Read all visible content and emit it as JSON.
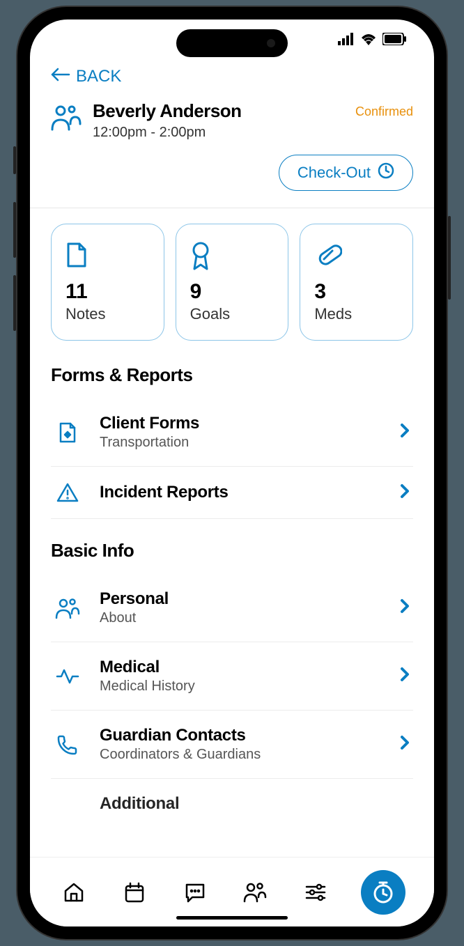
{
  "nav": {
    "back_label": "BACK"
  },
  "client": {
    "name": "Beverly Anderson",
    "time_range": "12:00pm - 2:00pm",
    "status": "Confirmed"
  },
  "checkout_label": "Check-Out",
  "cards": {
    "notes": {
      "count": "11",
      "label": "Notes"
    },
    "goals": {
      "count": "9",
      "label": "Goals"
    },
    "meds": {
      "count": "3",
      "label": "Meds"
    }
  },
  "sections": {
    "forms_title": "Forms & Reports",
    "basic_title": "Basic Info"
  },
  "forms": {
    "client_forms": {
      "title": "Client Forms",
      "sub": "Transportation"
    },
    "incident": {
      "title": "Incident Reports"
    }
  },
  "basic": {
    "personal": {
      "title": "Personal",
      "sub": "About"
    },
    "medical": {
      "title": "Medical",
      "sub": "Medical History"
    },
    "guardian": {
      "title": "Guardian Contacts",
      "sub": "Coordinators & Guardians"
    },
    "additional": {
      "title": "Additional"
    }
  }
}
